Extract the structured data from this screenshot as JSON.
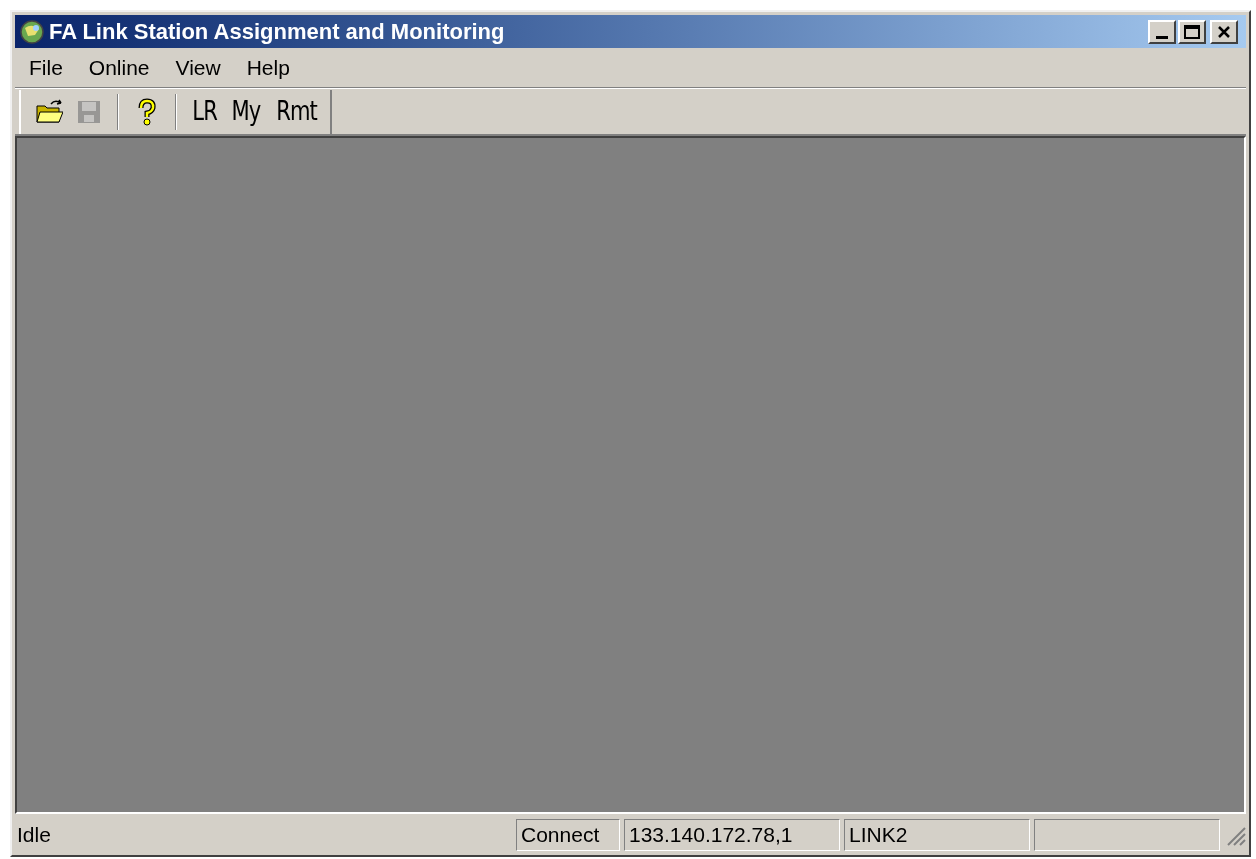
{
  "window": {
    "title": "FA Link Station Assignment and Monitoring"
  },
  "menu": [
    {
      "label": "File"
    },
    {
      "label": "Online"
    },
    {
      "label": "View"
    },
    {
      "label": "Help"
    }
  ],
  "toolbar": [
    {
      "kind": "open",
      "disabled": false
    },
    {
      "kind": "save",
      "disabled": true
    },
    {
      "kind": "separator"
    },
    {
      "kind": "help",
      "disabled": false
    },
    {
      "kind": "separator"
    },
    {
      "kind": "text",
      "label": "LR"
    },
    {
      "kind": "text",
      "label": "My"
    },
    {
      "kind": "text",
      "label": "Rmt"
    }
  ],
  "status_bar": {
    "message": "Idle",
    "panes": [
      "Connect",
      "133.140.172.78,1",
      "LINK2"
    ]
  }
}
